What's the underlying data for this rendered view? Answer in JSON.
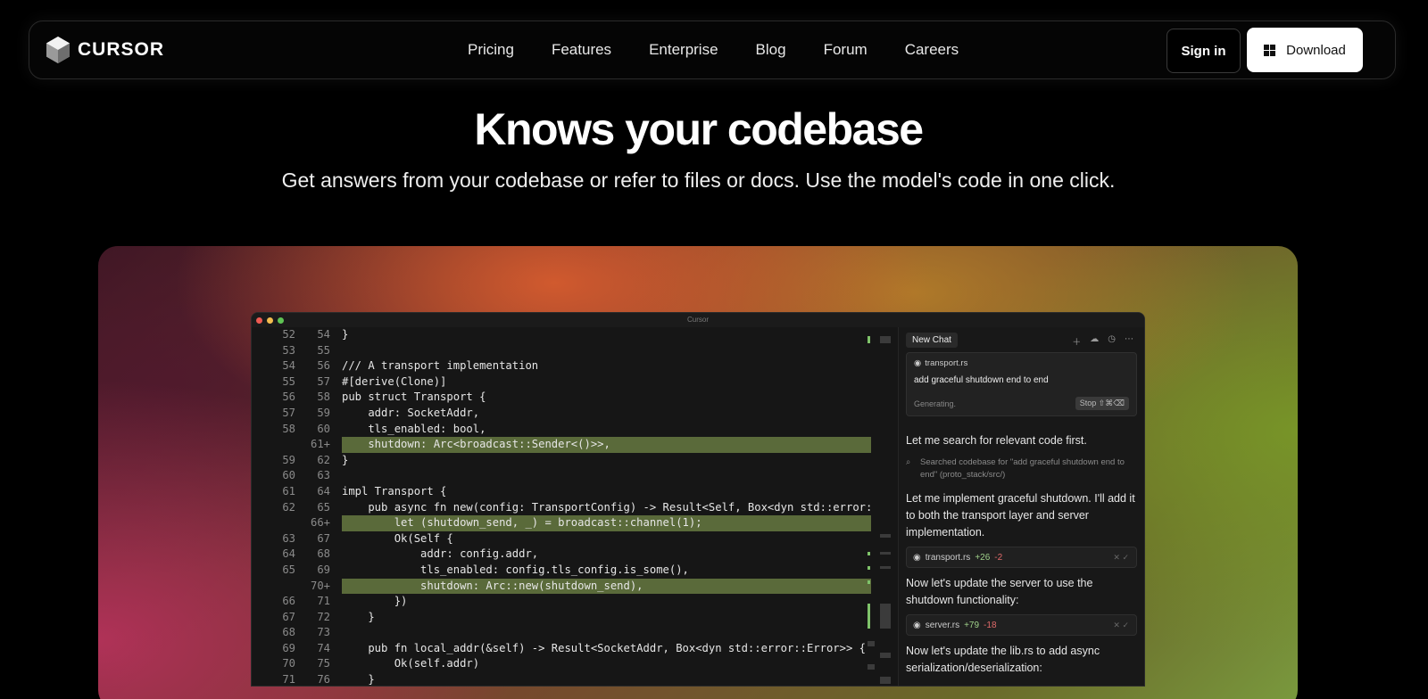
{
  "nav": {
    "brand": "CURSOR",
    "links": [
      "Pricing",
      "Features",
      "Enterprise",
      "Blog",
      "Forum",
      "Careers"
    ],
    "signin_label": "Sign in",
    "download_label": "Download"
  },
  "hero": {
    "title": "Knows your codebase",
    "subtitle": "Get answers from your codebase or refer to files or docs. Use the model's code in one click."
  },
  "editor": {
    "window_title": "Cursor",
    "code_lines": [
      {
        "a": "52",
        "b": "54",
        "text": "}",
        "added": false
      },
      {
        "a": "53",
        "b": "55",
        "text": "",
        "added": false
      },
      {
        "a": "54",
        "b": "56",
        "text": "/// A transport implementation",
        "added": false
      },
      {
        "a": "55",
        "b": "57",
        "text": "#[derive(Clone)]",
        "added": false
      },
      {
        "a": "56",
        "b": "58",
        "text": "pub struct Transport {",
        "added": false
      },
      {
        "a": "57",
        "b": "59",
        "text": "    addr: SocketAddr,",
        "added": false
      },
      {
        "a": "58",
        "b": "60",
        "text": "    tls_enabled: bool,",
        "added": false
      },
      {
        "a": "",
        "b": "61+",
        "text": "    shutdown: Arc<broadcast::Sender<()>>,",
        "added": true
      },
      {
        "a": "59",
        "b": "62",
        "text": "}",
        "added": false
      },
      {
        "a": "60",
        "b": "63",
        "text": "",
        "added": false
      },
      {
        "a": "61",
        "b": "64",
        "text": "impl Transport {",
        "added": false
      },
      {
        "a": "62",
        "b": "65",
        "text": "    pub async fn new(config: TransportConfig) -> Result<Self, Box<dyn std::error::Er",
        "added": false
      },
      {
        "a": "",
        "b": "66+",
        "text": "        let (shutdown_send, _) = broadcast::channel(1);",
        "added": true
      },
      {
        "a": "63",
        "b": "67",
        "text": "        Ok(Self {",
        "added": false
      },
      {
        "a": "64",
        "b": "68",
        "text": "            addr: config.addr,",
        "added": false
      },
      {
        "a": "65",
        "b": "69",
        "text": "            tls_enabled: config.tls_config.is_some(),",
        "added": false
      },
      {
        "a": "",
        "b": "70+",
        "text": "            shutdown: Arc::new(shutdown_send),",
        "added": true
      },
      {
        "a": "66",
        "b": "71",
        "text": "        })",
        "added": false
      },
      {
        "a": "67",
        "b": "72",
        "text": "    }",
        "added": false
      },
      {
        "a": "68",
        "b": "73",
        "text": "",
        "added": false
      },
      {
        "a": "69",
        "b": "74",
        "text": "    pub fn local_addr(&self) -> Result<SocketAddr, Box<dyn std::error::Error>> {",
        "added": false
      },
      {
        "a": "70",
        "b": "75",
        "text": "        Ok(self.addr)",
        "added": false
      },
      {
        "a": "71",
        "b": "76",
        "text": "    }",
        "added": false
      }
    ]
  },
  "chat": {
    "tab_label": "New Chat",
    "context_file": "transport.rs",
    "prompt": "add graceful shutdown end to end",
    "status": "Generating.",
    "stop_label": "Stop",
    "stop_shortcut": "⇧⌘⌫",
    "msg1": "Let me search for relevant code first.",
    "search_note": "Searched codebase for \"add graceful shutdown end to end\" (proto_stack/src/)",
    "msg2": "Let me implement graceful shutdown. I'll add it to both the transport layer and server implementation.",
    "diff1": {
      "file": "transport.rs",
      "plus": "+26",
      "minus": "-2"
    },
    "msg3": "Now let's update the server to use the shutdown functionality:",
    "diff2": {
      "file": "server.rs",
      "plus": "+79",
      "minus": "-18"
    },
    "msg4": "Now let's update the lib.rs to add async serialization/deserialization:"
  }
}
